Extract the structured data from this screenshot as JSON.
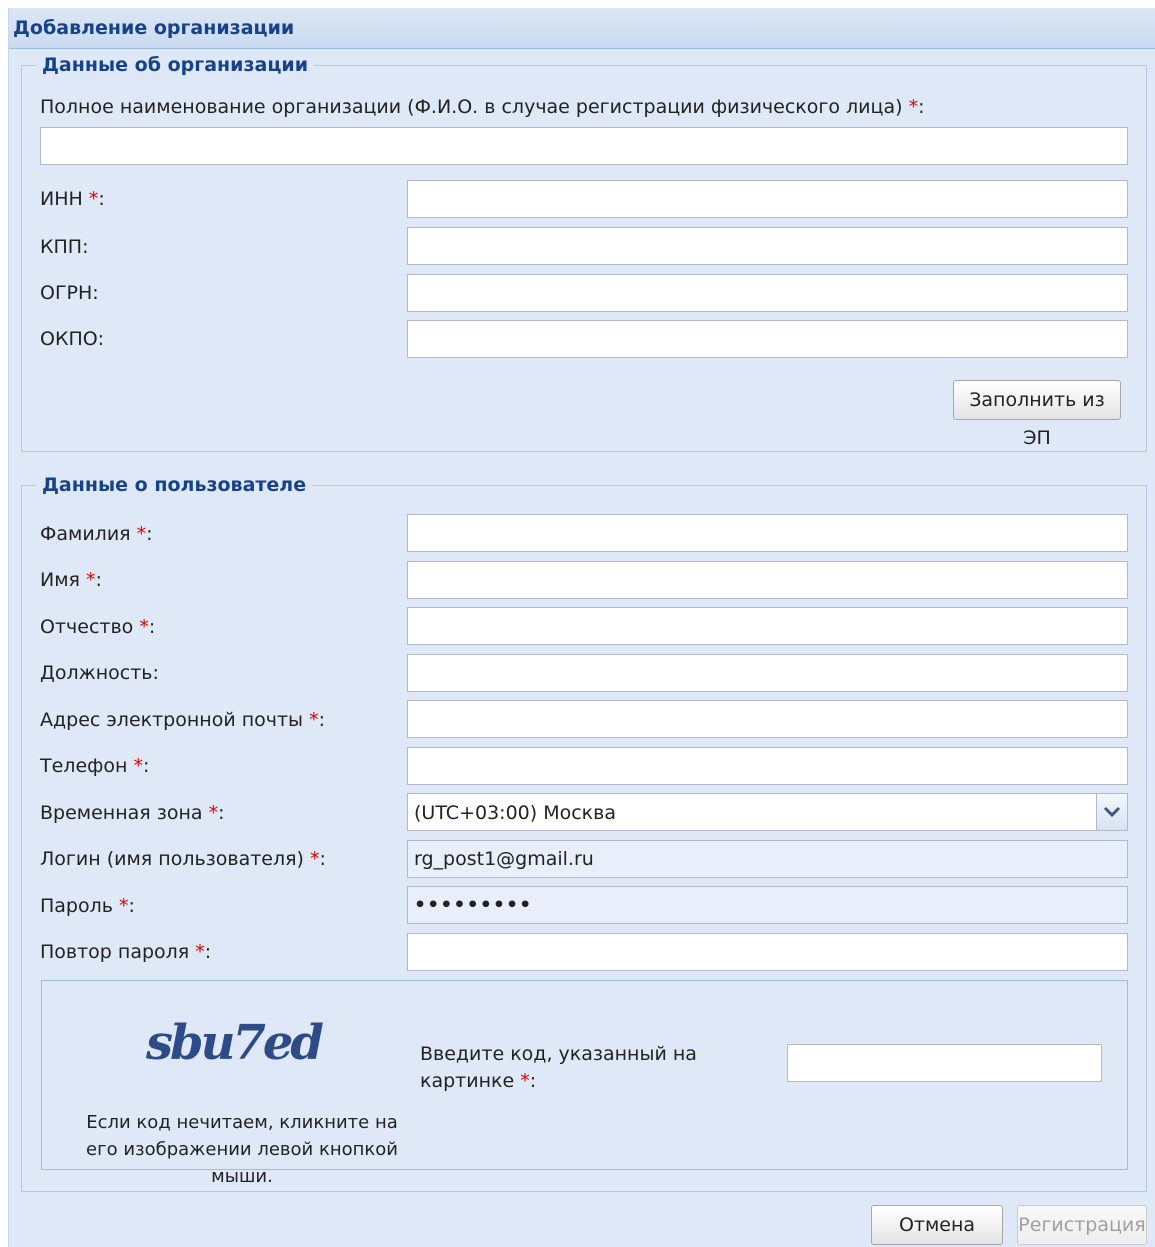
{
  "window": {
    "title": "Добавление организации"
  },
  "org": {
    "legend": "Данные об организации",
    "fullname_label": "Полное наименование организации (Ф.И.О. в случае регистрации физического лица)",
    "fullname_value": "",
    "inn_label": "ИНН",
    "kpp_label": "КПП:",
    "ogrn_label": "ОГРН:",
    "okpo_label": "ОКПО:",
    "fill_button": "Заполнить из ЭП"
  },
  "user": {
    "legend": "Данные о пользователе",
    "lastname_label": "Фамилия",
    "firstname_label": "Имя",
    "middlename_label": "Отчество",
    "position_label": "Должность:",
    "email_label": "Адрес электронной почты",
    "phone_label": "Телефон",
    "timezone_label": "Временная зона",
    "timezone_value": "(UTC+03:00) Москва",
    "login_label": "Логин (имя пользователя)",
    "login_value": "rg_post1@gmail.ru",
    "password_label": "Пароль",
    "password_value": "•••••••••",
    "password_repeat_label": "Повтор пароля"
  },
  "captcha": {
    "image_text": "sbu7ed",
    "hint": "Если код нечитаем, кликните на его изображении левой кнопкой мыши.",
    "input_label": "Введите код, указанный на картинке"
  },
  "required_mark": "*",
  "buttons": {
    "cancel": "Отмена",
    "register": "Регистрация"
  },
  "colors": {
    "title": "#15428b",
    "required": "#e00000",
    "panel_bg": "#dfe8f6",
    "border": "#99bbe8"
  }
}
